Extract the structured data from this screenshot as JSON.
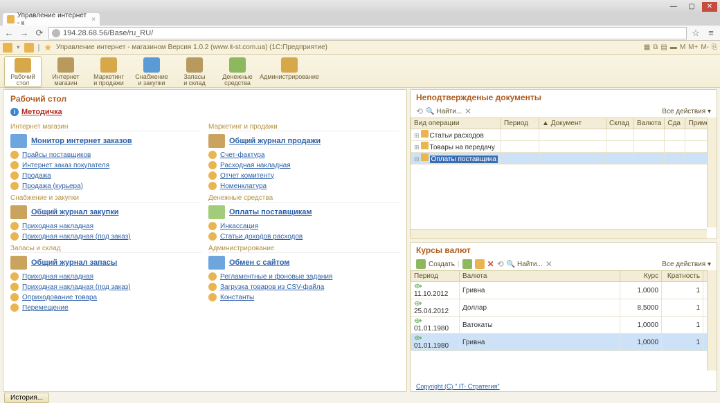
{
  "browser": {
    "tab_title": "Управление интернет - к",
    "url": "194.28.68.56/Base/ru_RU/"
  },
  "sysbar": {
    "title": "Управление интернет - магазином Версия 1.0.2 (www.it-st.com.ua) (1С:Предприятие)"
  },
  "nav": [
    {
      "l1": "Рабочий",
      "l2": "стол"
    },
    {
      "l1": "Интернет",
      "l2": "магазин"
    },
    {
      "l1": "Маркетинг",
      "l2": "и продажи"
    },
    {
      "l1": "Снабжение",
      "l2": "и закупки"
    },
    {
      "l1": "Запасы",
      "l2": "и склад"
    },
    {
      "l1": "Денежные",
      "l2": "средства"
    },
    {
      "l1": "Администрирование",
      "l2": ""
    }
  ],
  "desktop": {
    "title": "Рабочий стол",
    "method": "Методичка",
    "sections": {
      "inet": {
        "title": "Интернет магазин",
        "main": "Монитор интернет заказов",
        "links": [
          "Прайсы поставщиков",
          "Интернет заказ покупателя",
          "Продажа",
          "Продажа (курьера)"
        ]
      },
      "mkt": {
        "title": "Маркетинг и продажи",
        "main": "Общий журнал продажи",
        "links": [
          "Счет-фактура",
          "Расходная накладная",
          "Отчет комитенту",
          "Номенклатура"
        ]
      },
      "sup": {
        "title": "Снабжение и закупки",
        "main": "Общий журнал закупки",
        "links": [
          "Приходная накладная",
          "Приходная накладная (под заказ)"
        ]
      },
      "mon": {
        "title": "Денежные средства",
        "main": "Оплаты поставщикам",
        "links": [
          "Инкассация",
          "Статьи доходов расходов"
        ]
      },
      "stk": {
        "title": "Запасы и склад",
        "main": "Общий журнал запасы",
        "links": [
          "Приходная накладная",
          "Приходная накладная (под заказ)",
          "Оприходование товара",
          "Перемещение"
        ]
      },
      "adm": {
        "title": "Администрирование",
        "main": "Обмен с сайтом",
        "links": [
          "Регламентные и фоновые задания",
          "Загрузка товаров из CSV-файла",
          "Константы"
        ]
      }
    }
  },
  "docs": {
    "title": "Неподтвержденые документы",
    "find": "Найти...",
    "all_actions": "Все действия",
    "cols": {
      "op": "Вид операции",
      "per": "Период",
      "doc": "Документ",
      "wh": "Склад",
      "cur": "Валюта",
      "sum": "Сда",
      "note": "Примеч"
    },
    "rows": [
      "Статьи расходов",
      "Товары на передачу",
      "Оплаты поставщика"
    ]
  },
  "rates": {
    "title": "Курсы валют",
    "create": "Создать",
    "find": "Найти...",
    "all_actions": "Все действия",
    "cols": {
      "per": "Период",
      "cur": "Валюта",
      "rate": "Курс",
      "mult": "Кратность"
    },
    "rows": [
      {
        "d": "11.10.2012",
        "c": "Гривна",
        "r": "1,0000",
        "m": "1"
      },
      {
        "d": "25.04.2012",
        "c": "Доллар",
        "r": "8,5000",
        "m": "1"
      },
      {
        "d": "01.01.1980",
        "c": "Ватокаты",
        "r": "1,0000",
        "m": "1"
      },
      {
        "d": "01.01.1980",
        "c": "Гривна",
        "r": "1,0000",
        "m": "1"
      }
    ]
  },
  "copyright": "Copyright (С) \" IT- Стратегия\"",
  "history": "История..."
}
